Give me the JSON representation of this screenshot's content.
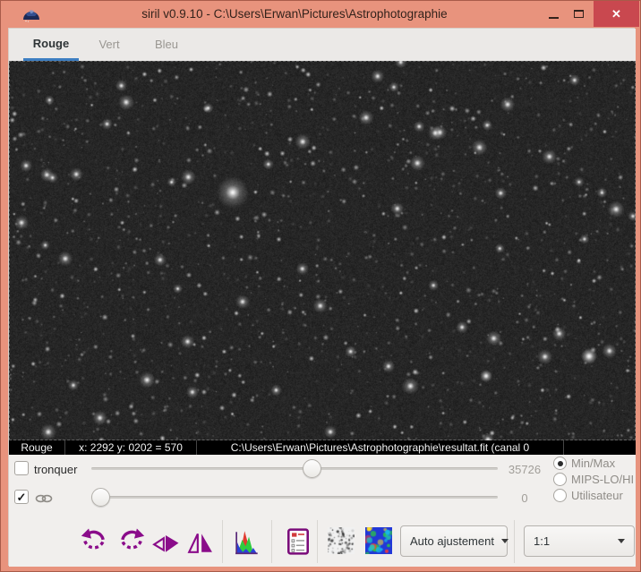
{
  "window": {
    "title": "siril v0.9.10 - C:\\Users\\Erwan\\Pictures\\Astrophotographie"
  },
  "tabs": [
    {
      "label": "Rouge",
      "active": true
    },
    {
      "label": "Vert",
      "active": false
    },
    {
      "label": "Bleu",
      "active": false
    }
  ],
  "statusbar": {
    "channel": "Rouge",
    "cursor": "x: 2292 y: 0202 = 570",
    "file": "C:\\Users\\Erwan\\Pictures\\Astrophotographie\\resultat.fit (canal 0"
  },
  "levels": {
    "truncate_label": "tronquer",
    "truncate_checked": false,
    "linked_checked": true,
    "hi": {
      "value": 35726,
      "max": 65535,
      "display": "35726"
    },
    "lo": {
      "value": 0,
      "max": 65535,
      "display": "0"
    },
    "modes": [
      {
        "label": "Min/Max",
        "selected": true
      },
      {
        "label": "MIPS-LO/HI",
        "selected": false
      },
      {
        "label": "Utilisateur",
        "selected": false
      }
    ]
  },
  "toolbar": {
    "stretch_mode": "Auto ajustement",
    "zoom": "1:1",
    "icons": [
      "rotate-ccw",
      "rotate-cw",
      "flip-horizontal",
      "flip-vertical",
      "histogram",
      "frame-list",
      "negative-view",
      "false-color-view"
    ]
  },
  "colors": {
    "titlebar": "#e8937d",
    "close_button": "#c9484f",
    "tab_accent": "#3d7ec1",
    "icon_purple": "#8a0c8a",
    "statusbar_bg": "#000000"
  }
}
